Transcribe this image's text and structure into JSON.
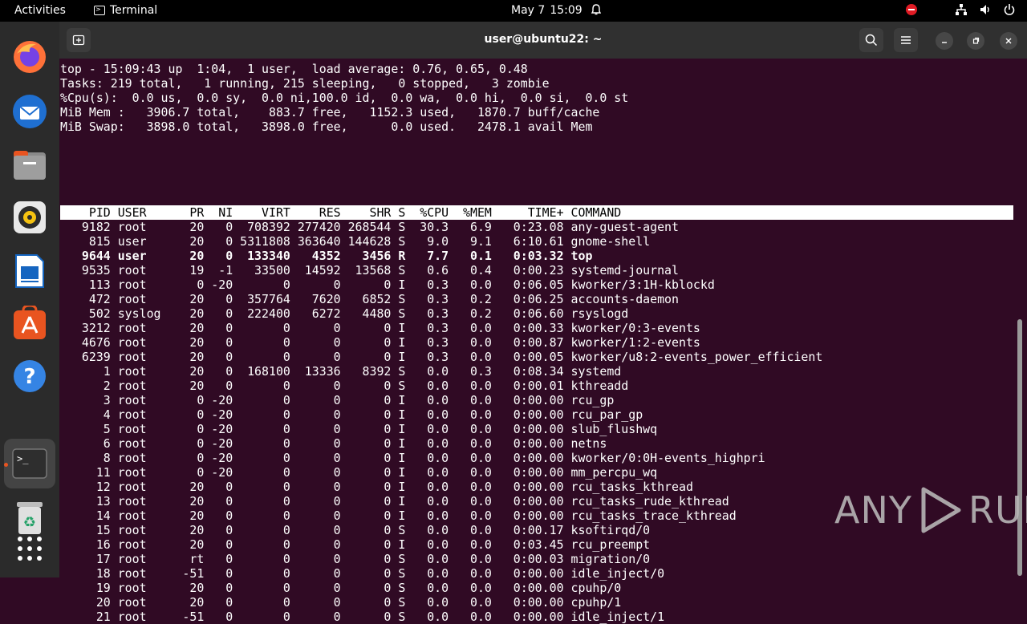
{
  "topbar": {
    "activities": "Activities",
    "app_name": "Terminal",
    "date": "May 7",
    "time": "15:09"
  },
  "window": {
    "title": "user@ubuntu22: ~"
  },
  "top": {
    "summary": [
      "top - 15:09:43 up  1:04,  1 user,  load average: 0.76, 0.65, 0.48",
      "Tasks: 219 total,   1 running, 215 sleeping,   0 stopped,   3 zombie",
      "%Cpu(s):  0.0 us,  0.0 sy,  0.0 ni,100.0 id,  0.0 wa,  0.0 hi,  0.0 si,  0.0 st",
      "MiB Mem :   3906.7 total,    883.7 free,   1152.3 used,   1870.7 buff/cache",
      "MiB Swap:   3898.0 total,   3898.0 free,      0.0 used.   2478.1 avail Mem"
    ],
    "header": "    PID USER      PR  NI    VIRT    RES    SHR S  %CPU  %MEM     TIME+ COMMAND",
    "rows": [
      {
        "text": "   9182 root      20   0  708392 277420 268544 S  30.3   6.9   0:23.08 any-guest-agent",
        "bold": false
      },
      {
        "text": "    815 user      20   0 5311808 363640 144628 S   9.0   9.1   6:10.61 gnome-shell",
        "bold": false
      },
      {
        "text": "   9644 user      20   0  133340   4352   3456 R   7.7   0.1   0:03.32 top",
        "bold": true
      },
      {
        "text": "   9535 root      19  -1   33500  14592  13568 S   0.6   0.4   0:00.23 systemd-journal",
        "bold": false
      },
      {
        "text": "    113 root       0 -20       0      0      0 I   0.3   0.0   0:06.05 kworker/3:1H-kblockd",
        "bold": false
      },
      {
        "text": "    472 root      20   0  357764   7620   6852 S   0.3   0.2   0:06.25 accounts-daemon",
        "bold": false
      },
      {
        "text": "    502 syslog    20   0  222400   6272   4480 S   0.3   0.2   0:06.60 rsyslogd",
        "bold": false
      },
      {
        "text": "   3212 root      20   0       0      0      0 I   0.3   0.0   0:00.33 kworker/0:3-events",
        "bold": false
      },
      {
        "text": "   4676 root      20   0       0      0      0 I   0.3   0.0   0:00.87 kworker/1:2-events",
        "bold": false
      },
      {
        "text": "   6239 root      20   0       0      0      0 I   0.3   0.0   0:00.05 kworker/u8:2-events_power_efficient",
        "bold": false
      },
      {
        "text": "      1 root      20   0  168100  13336   8392 S   0.0   0.3   0:08.34 systemd",
        "bold": false
      },
      {
        "text": "      2 root      20   0       0      0      0 S   0.0   0.0   0:00.01 kthreadd",
        "bold": false
      },
      {
        "text": "      3 root       0 -20       0      0      0 I   0.0   0.0   0:00.00 rcu_gp",
        "bold": false
      },
      {
        "text": "      4 root       0 -20       0      0      0 I   0.0   0.0   0:00.00 rcu_par_gp",
        "bold": false
      },
      {
        "text": "      5 root       0 -20       0      0      0 I   0.0   0.0   0:00.00 slub_flushwq",
        "bold": false
      },
      {
        "text": "      6 root       0 -20       0      0      0 I   0.0   0.0   0:00.00 netns",
        "bold": false
      },
      {
        "text": "      8 root       0 -20       0      0      0 I   0.0   0.0   0:00.00 kworker/0:0H-events_highpri",
        "bold": false
      },
      {
        "text": "     11 root       0 -20       0      0      0 I   0.0   0.0   0:00.00 mm_percpu_wq",
        "bold": false
      },
      {
        "text": "     12 root      20   0       0      0      0 I   0.0   0.0   0:00.00 rcu_tasks_kthread",
        "bold": false
      },
      {
        "text": "     13 root      20   0       0      0      0 I   0.0   0.0   0:00.00 rcu_tasks_rude_kthread",
        "bold": false
      },
      {
        "text": "     14 root      20   0       0      0      0 I   0.0   0.0   0:00.00 rcu_tasks_trace_kthread",
        "bold": false
      },
      {
        "text": "     15 root      20   0       0      0      0 S   0.0   0.0   0:00.17 ksoftirqd/0",
        "bold": false
      },
      {
        "text": "     16 root      20   0       0      0      0 I   0.0   0.0   0:03.45 rcu_preempt",
        "bold": false
      },
      {
        "text": "     17 root      rt   0       0      0      0 S   0.0   0.0   0:00.03 migration/0",
        "bold": false
      },
      {
        "text": "     18 root     -51   0       0      0      0 S   0.0   0.0   0:00.00 idle_inject/0",
        "bold": false
      },
      {
        "text": "     19 root      20   0       0      0      0 S   0.0   0.0   0:00.00 cpuhp/0",
        "bold": false
      },
      {
        "text": "     20 root      20   0       0      0      0 S   0.0   0.0   0:00.00 cpuhp/1",
        "bold": false
      },
      {
        "text": "     21 root     -51   0       0      0      0 S   0.0   0.0   0:00.00 idle_inject/1",
        "bold": false
      }
    ]
  },
  "watermark": {
    "left": "ANY",
    "right": "RUN"
  },
  "colors": {
    "terminal_bg": "#300a24",
    "accent": "#e95420"
  }
}
